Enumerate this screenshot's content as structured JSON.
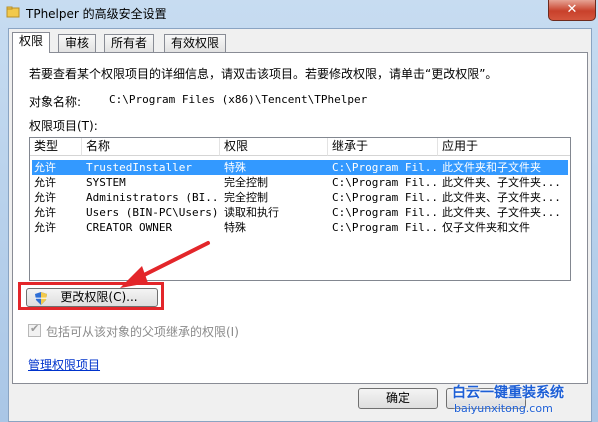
{
  "window": {
    "title": "TPhelper 的高级安全设置",
    "close_glyph": "✕"
  },
  "tabs": [
    {
      "label": "权限"
    },
    {
      "label": "审核"
    },
    {
      "label": "所有者"
    },
    {
      "label": "有效权限"
    }
  ],
  "description": "若要查看某个权限项目的详细信息，请双击该项目。若要修改权限，请单击“更改权限”。",
  "object": {
    "label": "对象名称:",
    "value": "C:\\Program Files (x86)\\Tencent\\TPhelper"
  },
  "entries_label": "权限项目(T):",
  "columns": [
    "类型",
    "名称",
    "权限",
    "继承于",
    "应用于"
  ],
  "rows": [
    {
      "type": "允许",
      "name": "TrustedInstaller",
      "perm": "特殊",
      "inherit": "C:\\Program Fil...",
      "apply": "此文件夹和子文件夹"
    },
    {
      "type": "允许",
      "name": "SYSTEM",
      "perm": "完全控制",
      "inherit": "C:\\Program Fil...",
      "apply": "此文件夹、子文件夹..."
    },
    {
      "type": "允许",
      "name": "Administrators (BI...",
      "perm": "完全控制",
      "inherit": "C:\\Program Fil...",
      "apply": "此文件夹、子文件夹..."
    },
    {
      "type": "允许",
      "name": "Users (BIN-PC\\Users)",
      "perm": "读取和执行",
      "inherit": "C:\\Program Fil...",
      "apply": "此文件夹、子文件夹..."
    },
    {
      "type": "允许",
      "name": "CREATOR OWNER",
      "perm": "特殊",
      "inherit": "C:\\Program Fil...",
      "apply": "仅子文件夹和文件"
    }
  ],
  "change_button": "更改权限(C)...",
  "inherit_checkbox": {
    "label": "包括可从该对象的父项继承的权限(I)",
    "checked": true
  },
  "manage_link": "管理权限项目",
  "ok_button": "确定",
  "watermark": {
    "line1": "白云一键重装系统",
    "line2": "baiyunxitong.com"
  },
  "colors": {
    "accent": "#3399ff",
    "highlight_red": "#e3262a",
    "link": "#0033cc"
  }
}
